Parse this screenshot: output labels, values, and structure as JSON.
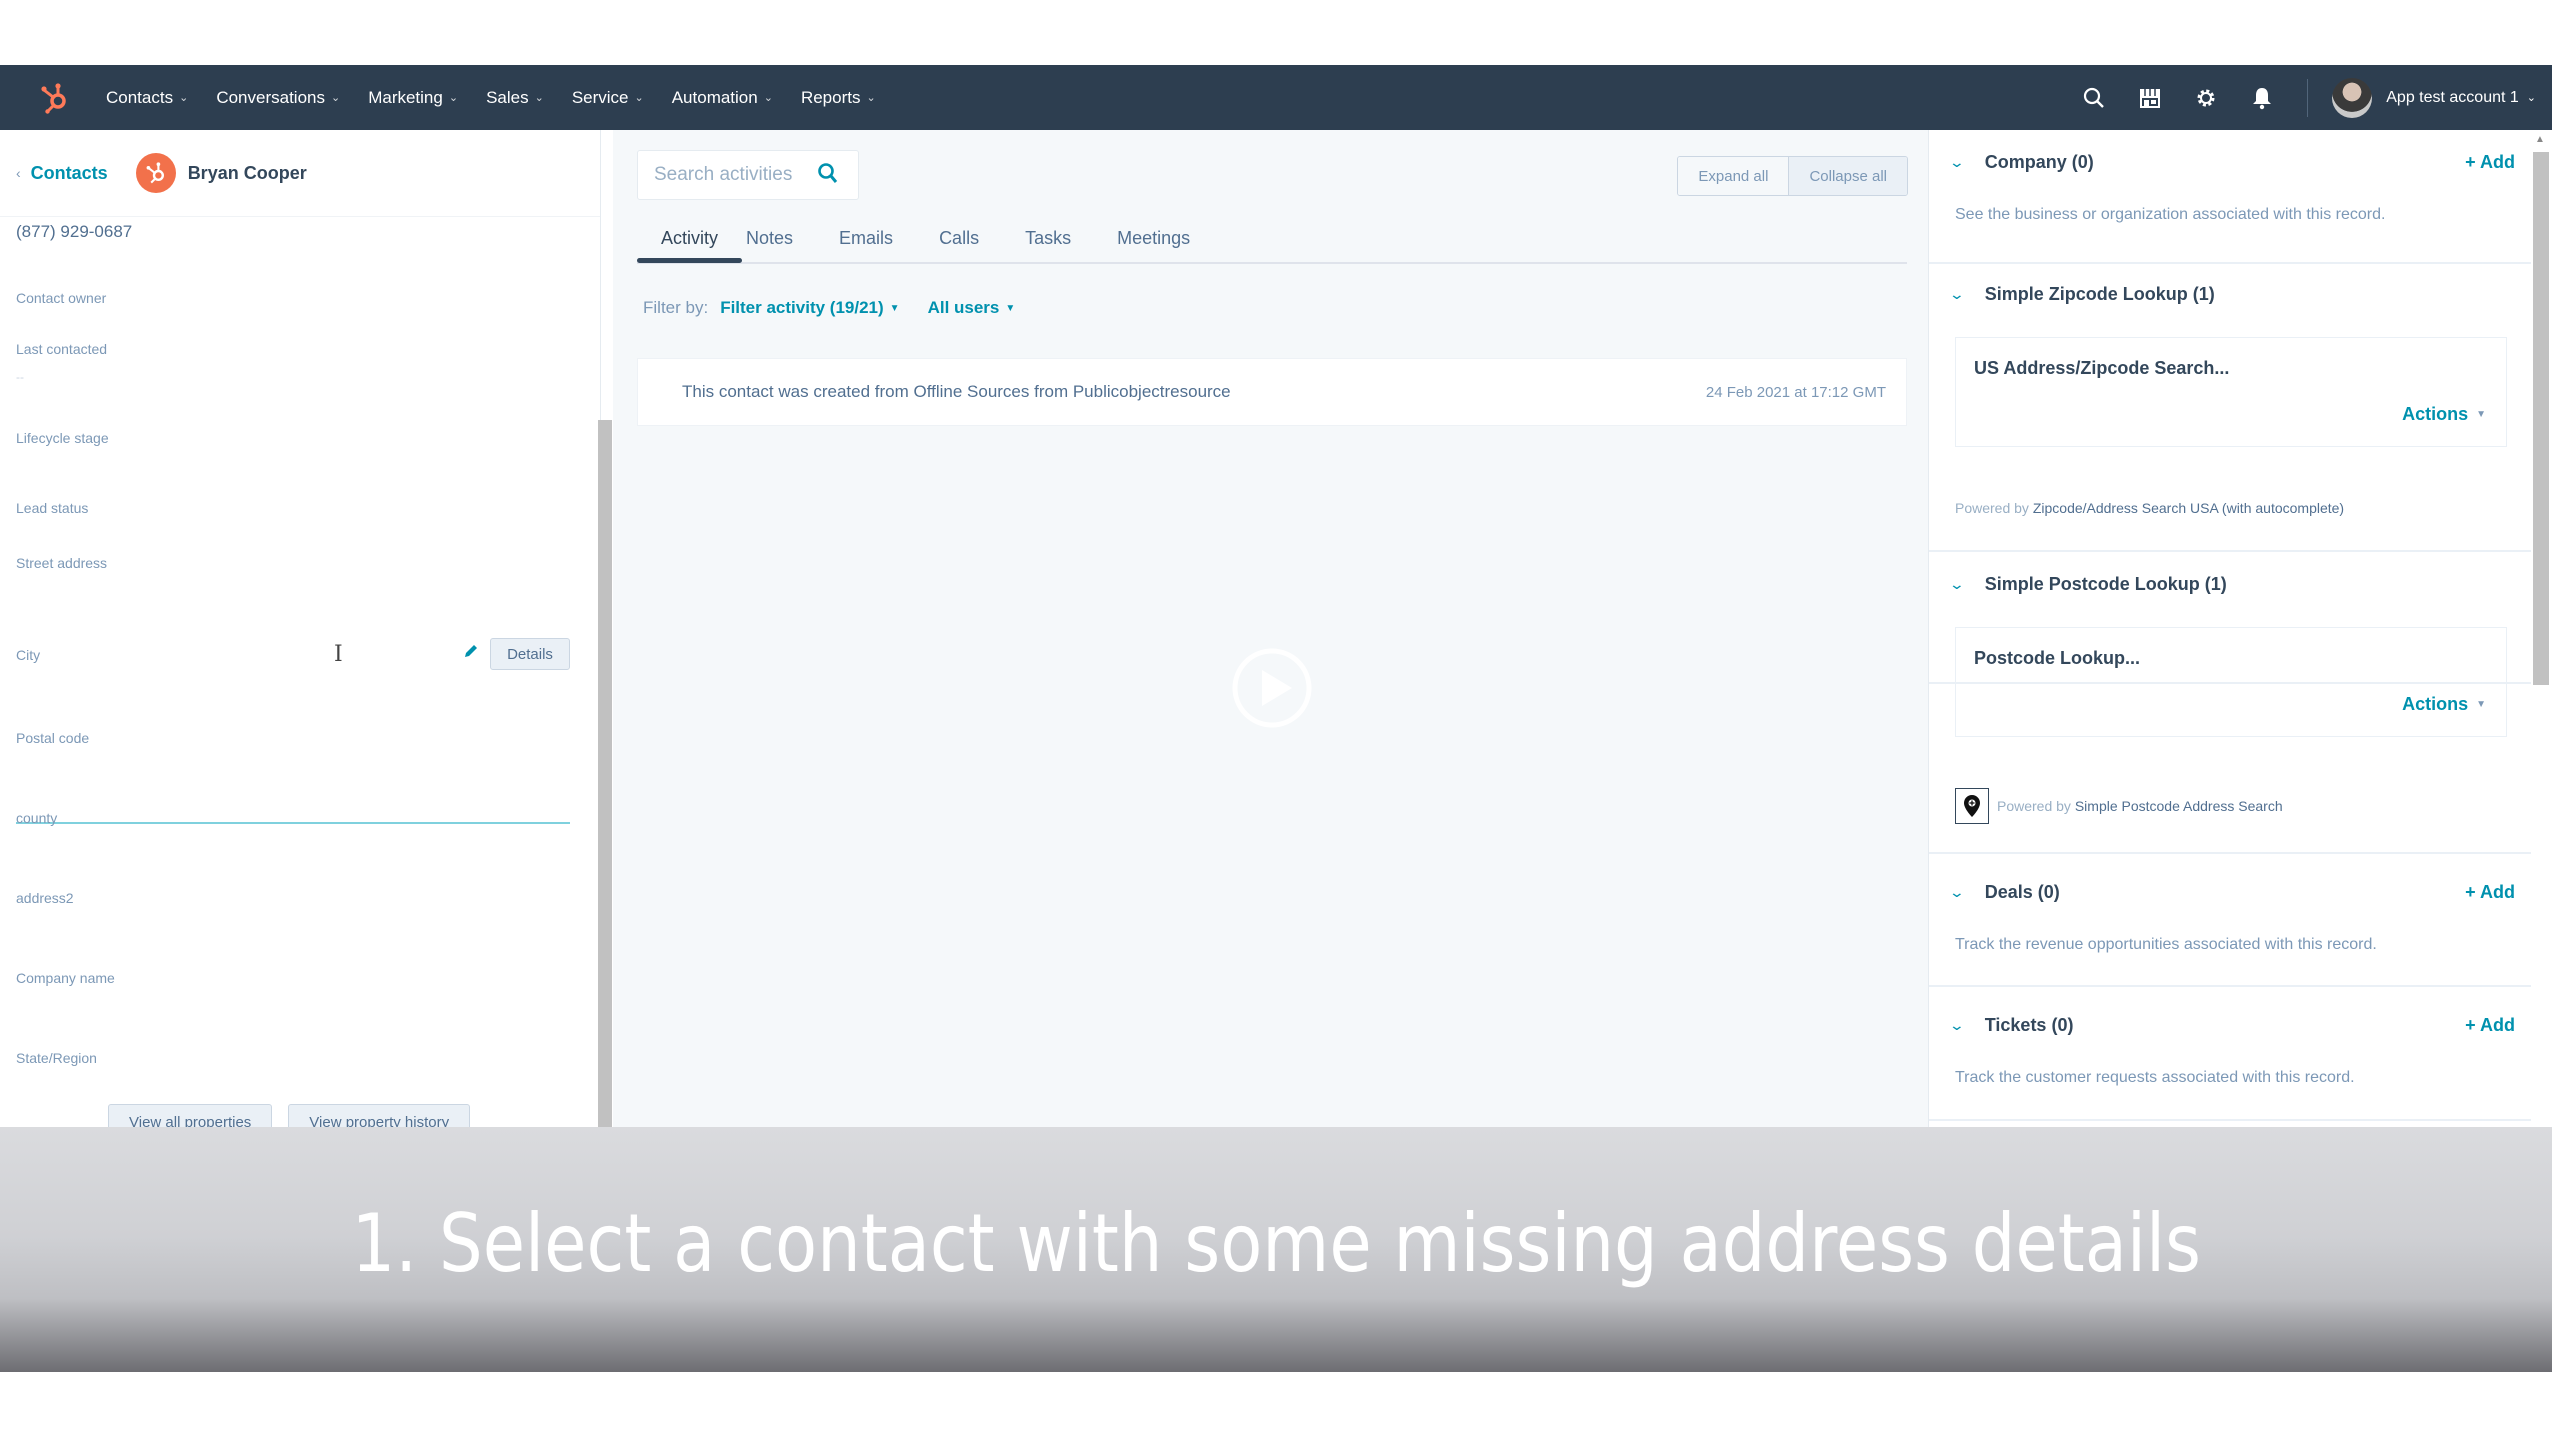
{
  "nav": {
    "items": [
      {
        "label": "Contacts"
      },
      {
        "label": "Conversations"
      },
      {
        "label": "Marketing"
      },
      {
        "label": "Sales"
      },
      {
        "label": "Service"
      },
      {
        "label": "Automation"
      },
      {
        "label": "Reports"
      }
    ],
    "icons": [
      "search-icon",
      "marketplace-icon",
      "settings-gear-icon",
      "notifications-bell-icon"
    ],
    "account_name": "App test account 1",
    "colors": {
      "nav_bg": "#2d3e50",
      "brand": "#ff7a59",
      "link": "#0091ae"
    }
  },
  "record": {
    "back_label": "Contacts",
    "name": "Bryan Cooper",
    "phone": "(877) 929-0687",
    "properties": [
      {
        "label": "Contact owner",
        "value": ""
      },
      {
        "label": "Last contacted",
        "value": "--"
      },
      {
        "label": "Lifecycle stage",
        "value": ""
      },
      {
        "label": "Lead status",
        "value": ""
      },
      {
        "label": "Street address",
        "value": ""
      },
      {
        "label": "City",
        "value": ""
      },
      {
        "label": "Postal code",
        "value": ""
      },
      {
        "label": "county",
        "value": ""
      },
      {
        "label": "address2",
        "value": ""
      },
      {
        "label": "Company name",
        "value": ""
      },
      {
        "label": "State/Region",
        "value": ""
      }
    ],
    "details_button": "Details",
    "view_all_properties": "View all properties",
    "view_property_history": "View property history"
  },
  "activity": {
    "search_placeholder": "Search activities",
    "expand_all": "Expand all",
    "collapse_all": "Collapse all",
    "tabs": [
      {
        "label": "Activity",
        "active": true
      },
      {
        "label": "Notes"
      },
      {
        "label": "Emails"
      },
      {
        "label": "Calls"
      },
      {
        "label": "Tasks"
      },
      {
        "label": "Meetings"
      }
    ],
    "filter_by_label": "Filter by:",
    "filter_activity": "Filter activity (19/21)",
    "all_users": "All users",
    "items": [
      {
        "text": "This contact was created from Offline Sources from Publicobjectresource",
        "time": "24 Feb 2021 at 17:12 GMT"
      }
    ]
  },
  "sidebar": {
    "company": {
      "title": "Company (0)",
      "add": "+ Add",
      "desc": "See the business or organization associated with this record."
    },
    "zipcode": {
      "title": "Simple Zipcode Lookup (1)",
      "card_title": "US Address/Zipcode Search...",
      "actions": "Actions",
      "powered_prefix": "Powered by",
      "powered_name": "Zipcode/Address Search USA (with autocomplete)"
    },
    "postcode": {
      "title": "Simple Postcode Lookup (1)",
      "card_title": "Postcode Lookup...",
      "actions": "Actions",
      "powered_prefix": "Powered by",
      "powered_name": "Simple Postcode Address Search"
    },
    "deals": {
      "title": "Deals (0)",
      "add": "+ Add",
      "desc": "Track the revenue opportunities associated with this record."
    },
    "tickets": {
      "title": "Tickets (0)",
      "add": "+ Add",
      "desc": "Track the customer requests associated with this record."
    }
  },
  "overlay": {
    "caption": "1. Select a contact with some missing address details"
  }
}
